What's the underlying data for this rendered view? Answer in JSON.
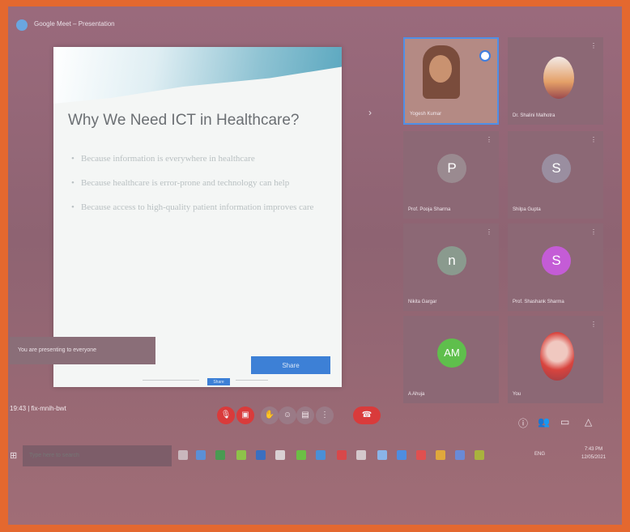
{
  "window": {
    "title": "Google Meet – Presentation"
  },
  "slide": {
    "title": "Why We Need ICT in Healthcare?",
    "bullets": [
      "Because information is everywhere in healthcare",
      "Because healthcare is error-prone and technology can help",
      "Because access to high-quality patient information improves care"
    ],
    "action_label": "Share",
    "small_button_label": "Share"
  },
  "presentation_banner": {
    "text": "You are presenting to everyone"
  },
  "participants": [
    {
      "name": "Yogesh Kumar",
      "initial": "",
      "color": "#b48a84"
    },
    {
      "name": "Dr. Shalini Malhotra",
      "initial": "",
      "color": "#8c6875"
    },
    {
      "name": "Prof. Pooja Sharma",
      "initial": "P",
      "color": "#9a8a90"
    },
    {
      "name": "Shilpa Gupta",
      "initial": "S",
      "color": "#9a8ea0"
    },
    {
      "name": "Nikita Gargar",
      "initial": "n",
      "color": "#8a9a8e"
    },
    {
      "name": "Prof. Shashank Sharma",
      "initial": "S",
      "color": "#c45cd6"
    },
    {
      "name": "A Ahuja",
      "initial": "AM",
      "color": "#5fbf4c"
    },
    {
      "name": "You",
      "initial": "",
      "color": "#8c6875"
    }
  ],
  "meeting_bar": {
    "time_and_code": "19:43 | fix-mnih-bwt"
  },
  "icons": {
    "mic": "mic-icon",
    "cam": "camera-icon",
    "hand": "raise-hand-icon",
    "emoji": "emoji-icon",
    "present": "present-screen-icon",
    "more": "more-options-icon",
    "leave": "leave-call-icon",
    "info": "info-icon",
    "people": "people-icon",
    "chat": "chat-icon",
    "activities": "activities-icon"
  },
  "taskbar": {
    "search_placeholder": "Type here to search",
    "tray_text": "ENG",
    "time": "7:43 PM",
    "date": "12/05/2021"
  }
}
